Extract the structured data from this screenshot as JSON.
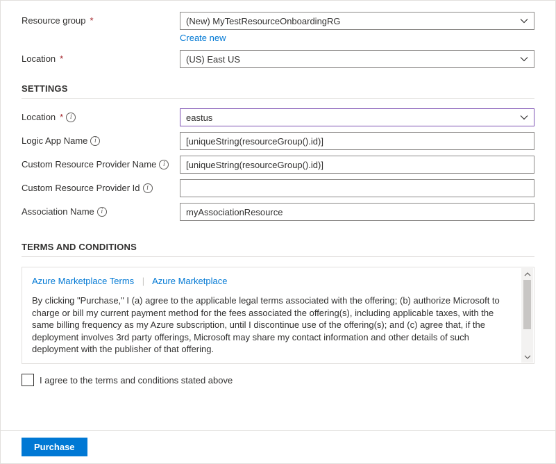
{
  "basics": {
    "resource_group": {
      "label": "Resource group",
      "value": "(New) MyTestResourceOnboardingRG",
      "create_new": "Create new"
    },
    "location": {
      "label": "Location",
      "value": "(US) East US"
    }
  },
  "settings": {
    "heading": "SETTINGS",
    "location": {
      "label": "Location",
      "value": "eastus"
    },
    "logic_app_name": {
      "label": "Logic App Name",
      "value": "[uniqueString(resourceGroup().id)]"
    },
    "custom_rp_name": {
      "label": "Custom Resource Provider Name",
      "value": "[uniqueString(resourceGroup().id)]"
    },
    "custom_rp_id": {
      "label": "Custom Resource Provider Id",
      "value": ""
    },
    "association_name": {
      "label": "Association Name",
      "value": "myAssociationResource"
    }
  },
  "terms": {
    "heading": "TERMS AND CONDITIONS",
    "link1": "Azure Marketplace Terms",
    "link2": "Azure Marketplace",
    "body": "By clicking \"Purchase,\" I (a) agree to the applicable legal terms associated with the offering; (b) authorize Microsoft to charge or bill my current payment method for the fees associated the offering(s), including applicable taxes, with the same billing frequency as my Azure subscription, until I discontinue use of the offering(s); and (c) agree that, if the deployment involves 3rd party offerings, Microsoft may share my contact information and other details of such deployment with the publisher of that offering.",
    "agree_label": "I agree to the terms and conditions stated above"
  },
  "footer": {
    "purchase": "Purchase"
  }
}
